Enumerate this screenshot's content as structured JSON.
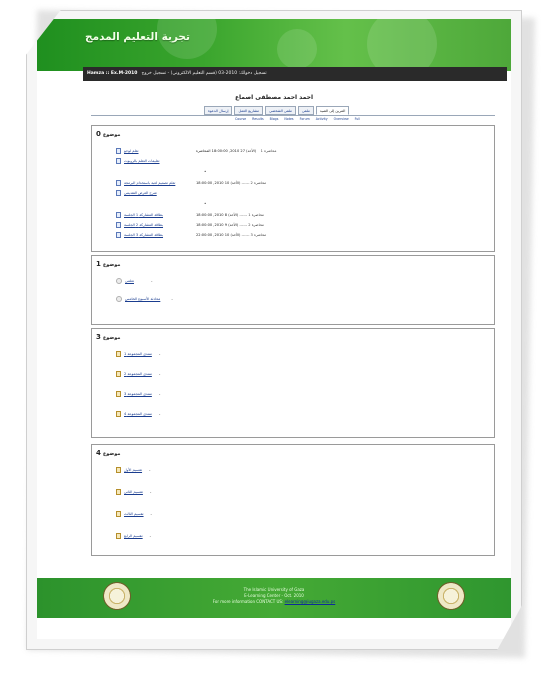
{
  "site": {
    "title": "تجربة التعليم المدمج"
  },
  "user_bar": {
    "user": "Hamza :: Ex.M-2010",
    "info": "تسجيل دخولك: 2010-03 (قسم التعليم الالكتروني) - تسجيل خروج"
  },
  "course": {
    "title": "احمد احمد مصطفى اصماع"
  },
  "tabs": [
    {
      "label": "المرين إلى الصيد"
    },
    {
      "label": "ملفي"
    },
    {
      "label": "ملفي الشخصي"
    },
    {
      "label": "مشاريع العمل"
    },
    {
      "label": "إرسال الدعوة"
    }
  ],
  "subtabs": [
    "Course",
    "Results",
    "Blogs",
    "Notes",
    "Forum",
    "Activity",
    "Overview",
    "Full"
  ],
  "topics": [
    {
      "label": "موضوع",
      "number": "0",
      "rows": [
        {
          "title": "تعلم لوجو",
          "icon": "page-icon",
          "kind": "محاضرة 1",
          "date": "(الأحد) 27 2010, 18:00:00 المحاضرة",
          "dash": ""
        },
        {
          "title": "تعليمات التعلم بالروبوت",
          "icon": "page-icon",
          "kind": "",
          "date": "",
          "dash": ""
        },
        {
          "title": "",
          "icon": "",
          "kind": "",
          "date": "",
          "dash": ""
        },
        {
          "title": "تعلم تصميم لعبة باستخدام البرمجة",
          "icon": "page-icon",
          "kind": "محاضرة 2",
          "date": "(الأحد) 10 2010, 18:00:00",
          "dash": "------"
        },
        {
          "title": "شرح العرض التقديمي",
          "icon": "page-icon",
          "kind": "",
          "date": "",
          "dash": ""
        },
        {
          "title": "",
          "icon": "",
          "kind": "",
          "date": "",
          "dash": ""
        },
        {
          "title": "بطاقة المشاركة 1 الجلسة",
          "icon": "page-icon",
          "kind": "محاضرة 1",
          "date": "(الأحد) 8 2010, 18:00:00",
          "dash": "------"
        },
        {
          "title": "بطاقة المشاركة 2 الجلسة",
          "icon": "page-icon",
          "kind": "محاضرة 2",
          "date": "(الأحد) 9 2010, 18:00:00",
          "dash": "------"
        },
        {
          "title": "بطاقة المشاركة 3 الجلسة",
          "icon": "page-icon",
          "kind": "محاضرة 3",
          "date": "(الأحد) 10 2010, 22:00:00",
          "dash": "------"
        }
      ]
    },
    {
      "label": "موضوع",
      "number": "1",
      "rows": [
        {
          "title": "تعلمي",
          "icon": "resource-icon",
          "kind": "",
          "date": "",
          "dash": ""
        },
        {
          "title": "محادثة الأسبوع الخامس",
          "icon": "resource-icon",
          "kind": "",
          "date": "",
          "dash": ""
        }
      ]
    },
    {
      "label": "موضوع",
      "number": "3",
      "rows": [
        {
          "title": "منتدى المجموعة 1",
          "icon": "forum-icon",
          "kind": "",
          "date": "",
          "dash": ""
        },
        {
          "title": "منتدى المجموعة 2",
          "icon": "forum-icon",
          "kind": "",
          "date": "",
          "dash": ""
        },
        {
          "title": "منتدى المجموعة 3",
          "icon": "forum-icon",
          "kind": "",
          "date": "",
          "dash": ""
        },
        {
          "title": "منتدى المجموعة 4",
          "icon": "forum-icon",
          "kind": "",
          "date": "",
          "dash": ""
        }
      ]
    },
    {
      "label": "موضوع",
      "number": "4",
      "rows": [
        {
          "title": "تقسيم الأول",
          "icon": "forum-icon",
          "kind": "",
          "date": "",
          "dash": ""
        },
        {
          "title": "تقسيم الثاني",
          "icon": "forum-icon",
          "kind": "",
          "date": "",
          "dash": ""
        },
        {
          "title": "تقسيم الثالث",
          "icon": "forum-icon",
          "kind": "",
          "date": "",
          "dash": ""
        },
        {
          "title": "تقسيم الرابع",
          "icon": "forum-icon",
          "kind": "",
          "date": "",
          "dash": ""
        }
      ]
    }
  ],
  "footer": {
    "line1": "The Islamic University of Gaza",
    "line2": "E-Learning Center - Oct. 2010",
    "line3": "For more information CONTACT US:",
    "email": "elearning@iugaza.edu.ps"
  },
  "colors": {
    "header_green": "#3aa52d",
    "footer_green": "#45aa35",
    "link_blue": "#1a3d8f"
  }
}
